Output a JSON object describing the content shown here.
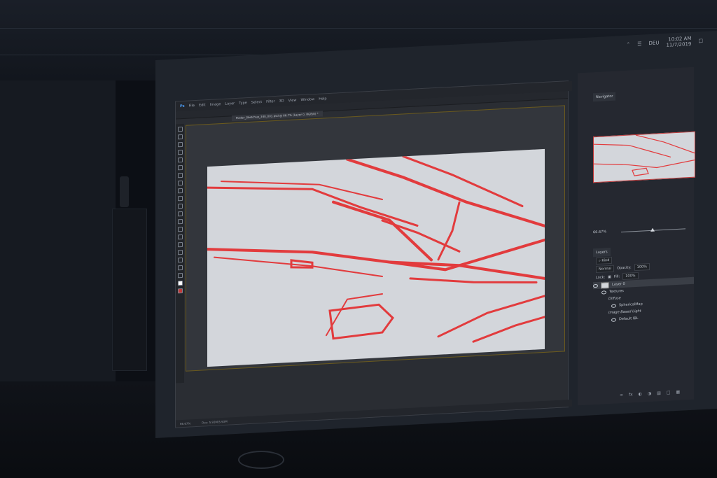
{
  "taskbar": {
    "language": "DEU",
    "time": "10:02 AM",
    "date": "11/7/2019"
  },
  "menu": [
    "Ps",
    "File",
    "Edit",
    "Image",
    "Layer",
    "Type",
    "Select",
    "Filter",
    "3D",
    "View",
    "Window",
    "Help"
  ],
  "document_tab": "Poster_Sketchup_340_001.psd @ 66.7% (Layer 0, RGB/8) *",
  "status": {
    "zoom": "66.67%",
    "doc": "Doc: 5.93M/5.93M"
  },
  "navigator": {
    "tab": "Navigator",
    "zoom": "66.67%"
  },
  "layers": {
    "tab": "Layers",
    "kind_label": "Kind",
    "blend_mode": "Normal",
    "opacity_label": "Opacity:",
    "opacity_value": "100%",
    "lock_label": "Lock:",
    "fill_label": "Fill:",
    "fill_value": "100%",
    "items": [
      "Layer 0",
      "Textures",
      "Diffuse",
      "SphericalMap",
      "Image Based Light",
      "Default IBL"
    ]
  },
  "colors": {
    "sketch_red": "#e23b3d",
    "canvas_bg": "#d3d6db",
    "canvas_border": "#6b5a1d"
  }
}
